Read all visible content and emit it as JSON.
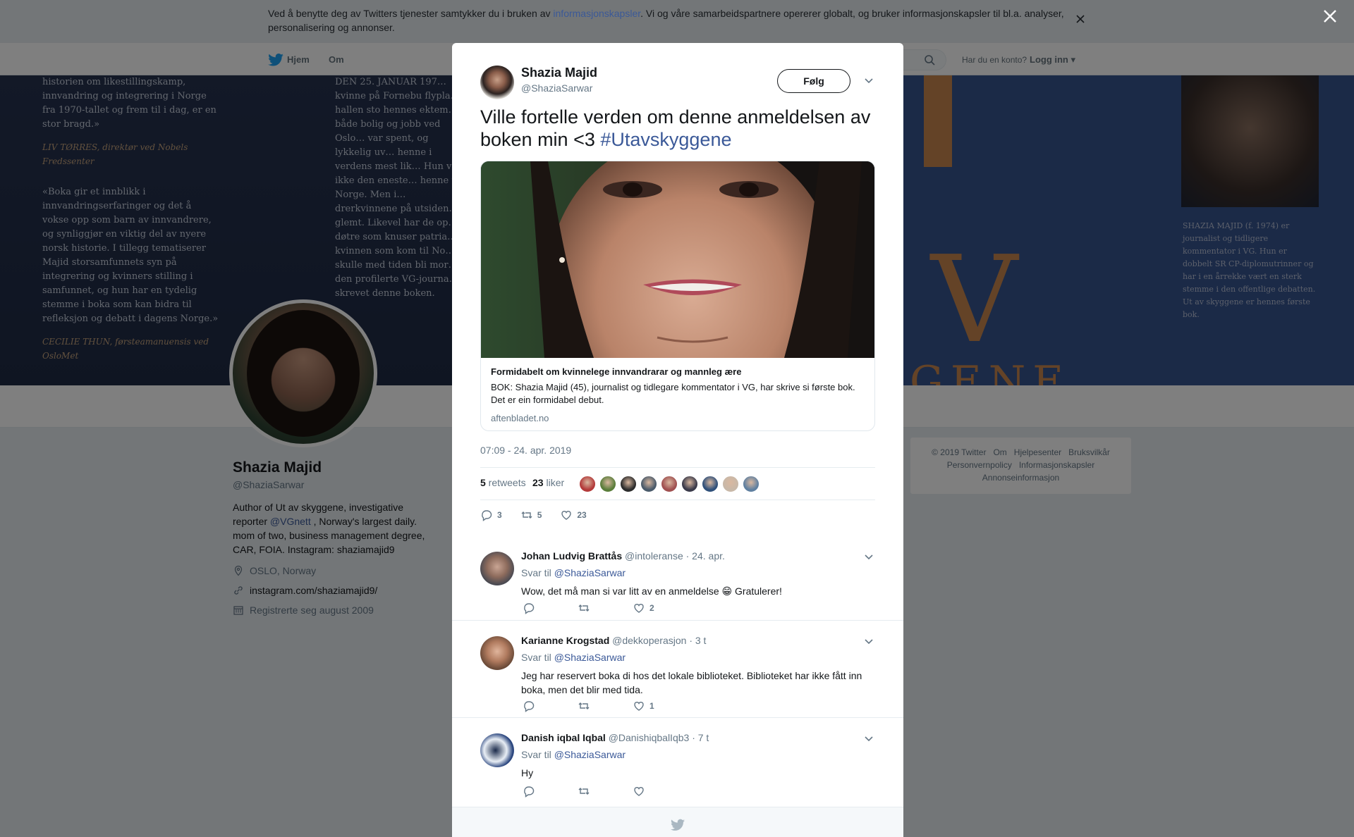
{
  "cookie_bar": {
    "text_before": "Ved å benytte deg av Twitters tjenester samtykker du i bruken av ",
    "link": "informasjonskapsler",
    "text_after": ". Vi og våre samarbeidspartnere opererer globalt, og bruker informasjonskapsler til bl.a. analyser, personalisering og annonser."
  },
  "nav": {
    "home": "Hjem",
    "about": "Om",
    "login_question": "Har du en konto?",
    "login": "Logg inn"
  },
  "banner": {
    "quote1": "historien om likestillingskamp, innvandring og integrering i Norge fra 1970-tallet og frem til i dag, er en stor bragd.»",
    "author1": "LIV TØRRES, direktør ved Nobels Fredssenter",
    "quote2": "«Boka gir et innblikk i innvandringserfaringer og det å vokse opp som barn av innvandrere, og synliggjør en viktig del av nyere norsk historie. I tillegg tematiserer Majid storsamfunnets syn på integrering og kvinners stilling i samfunnet, og hun har en tydelig stemme i boka som kan bidra til refleksjon og debatt i dagens Norge.»",
    "author2": "CECILIE THUN, førsteamanuensis ved OsloMet",
    "col2": "DEN 25. JANUAR 197… kvinne på Fornebu flypla… hallen sto hennes ektem… både bolig og jobb ved Oslo… var spent, og lykkelig uv… henne i verdens mest lik… Hun var ikke den eneste… henne til Norge. Men i… drerkvinnene på utsiden… glemt. Likevel har de op… døtre som knuser patria… kvinnen som kom til No… skulle med tiden bli mor… den profilerte VG-journa… skrevet denne boken.",
    "col3": "SHAZIA MAJID (f. 1974) er journalist og tidligere kommentator i VG. Hun er dobbelt SR CP-diplomutrinner og har i en årrekke vært en sterk stemme i den offentlige debatten. Ut av skyggene er hennes første bok.",
    "v": "V",
    "gene": "GENE"
  },
  "profile": {
    "name": "Shazia Majid",
    "handle": "@ShaziaSarwar",
    "bio_before": "Author of Ut av skyggene, investigative reporter ",
    "bio_mention": "@VGnett",
    "bio_after": " , Norway's largest daily. mom of two, business management degree, CAR, FOIA. Instagram: shaziamajid9",
    "location": "OSLO, Norway",
    "website": "instagram.com/shaziamajid9/",
    "joined": "Registrerte seg august 2009"
  },
  "footer": {
    "row1": [
      "© 2019 Twitter",
      "Om",
      "Hjelpesenter",
      "Bruksvilkår"
    ],
    "row2": [
      "Personvernpolicy",
      "Informasjonskapsler"
    ],
    "row3": [
      "Annonseinformasjon"
    ]
  },
  "tweet": {
    "name": "Shazia Majid",
    "handle": "@ShaziaSarwar",
    "follow": "Følg",
    "text": "Ville fortelle verden om denne anmeldelsen av boken min <3 ",
    "hashtag": "#Utavskyggene",
    "card": {
      "title": "Formidabelt om kvinnelege innvandrarar og mannleg ære",
      "description": "BOK: Shazia Majid (45), journalist og tidlegare kommentator i VG, har skrive si første bok. Det er ein formidabel debut.",
      "domain": "aftenbladet.no"
    },
    "timestamp": "07:09 - 24. apr. 2019",
    "retweets_count": "5",
    "retweets_label": " retweets",
    "likes_count": "23",
    "likes_label": " liker",
    "reply_count": "3",
    "retweet_count": "5",
    "like_count": "23",
    "liker_faces": [
      "#b33a3a",
      "#5a7d3a",
      "#2c2c2c",
      "#4a5a6a",
      "#a05050",
      "#3a3a4a",
      "#30507a",
      "#c8b8a8",
      "#6080a0"
    ]
  },
  "replies": [
    {
      "name": "Johan Ludvig Brattås",
      "handle": "@intoleranse",
      "time": "· 24. apr.",
      "reply_to_label": "Svar til ",
      "reply_to": "@ShaziaSarwar",
      "text": "Wow, det må man si var litt av en anmeldelse 😁 Gratulerer!",
      "like_count": "2"
    },
    {
      "name": "Karianne Krogstad",
      "handle": "@dekkoperasjon",
      "time": "· 3 t",
      "reply_to_label": "Svar til ",
      "reply_to": "@ShaziaSarwar",
      "text": "Jeg har reservert boka di hos det lokale biblioteket. Biblioteket har ikke fått inn boka, men det blir med tida.",
      "like_count": "1"
    },
    {
      "name": "Danish iqbal Iqbal",
      "handle": "@DanishiqbalIqb3",
      "time": "· 7 t",
      "reply_to_label": "Svar til ",
      "reply_to": "@ShaziaSarwar",
      "text": "Hy",
      "like_count": ""
    }
  ],
  "colors": {
    "link": "#3b5998",
    "muted": "#657786",
    "text": "#14171a",
    "banner_orange": "#c9874f"
  }
}
